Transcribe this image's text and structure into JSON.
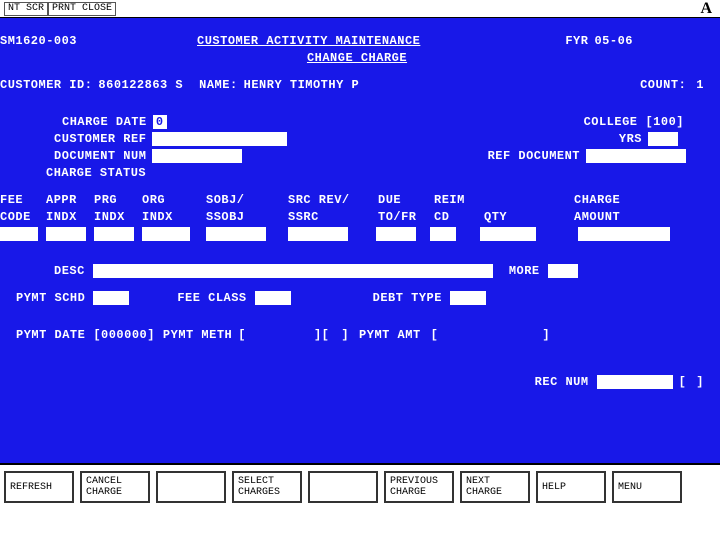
{
  "topbar": {
    "btn1": "NT SCR",
    "btn2": "PRNT CLOSE",
    "marker": "A"
  },
  "header": {
    "code": "SM1620-003",
    "title": "CUSTOMER ACTIVITY MAINTENANCE",
    "subtitle": "CHANGE CHARGE",
    "fyr_lbl": "FYR",
    "fyr_val": "05-06"
  },
  "cust": {
    "id_lbl": "CUSTOMER ID:",
    "id_val": "860122863 S",
    "name_lbl": "NAME:",
    "name_val": "HENRY TIMOTHY P",
    "count_lbl": "COUNT:",
    "count_val": "1"
  },
  "fields": {
    "charge_date": "CHARGE DATE",
    "charge_date_val": "0",
    "college": "COLLEGE",
    "college_val": "[100]",
    "cust_ref": "CUSTOMER REF",
    "yrs": "YRS",
    "doc_num": "DOCUMENT NUM",
    "ref_doc": "REF DOCUMENT",
    "charge_status": "CHARGE STATUS"
  },
  "cols": {
    "c1a": "FEE",
    "c1b": "CODE",
    "c2a": "APPR",
    "c2b": "INDX",
    "c3a": "PRG",
    "c3b": "INDX",
    "c4a": "ORG",
    "c4b": "INDX",
    "c5a": "SOBJ/",
    "c5b": "SSOBJ",
    "c6a": "SRC REV/",
    "c6b": "SSRC",
    "c7a": "DUE",
    "c7b": "TO/FR",
    "c8a": "REIM",
    "c8b": "CD",
    "c9": "QTY",
    "c10a": "CHARGE",
    "c10b": "AMOUNT"
  },
  "desc": {
    "lbl": "DESC",
    "more": "MORE"
  },
  "pymt": {
    "schd": "PYMT SCHD",
    "fee_class": "FEE CLASS",
    "debt_type": "DEBT TYPE"
  },
  "pline": {
    "date_lbl": "PYMT DATE",
    "date_val": "[000000]",
    "meth_lbl": "PYMT METH",
    "br1": "[",
    "br2": "][",
    "br3": "]",
    "amt_lbl": "PYMT AMT",
    "br4": "[",
    "br5": "]"
  },
  "rec": {
    "lbl": "REC NUM",
    "br1": "[",
    "br2": "]"
  },
  "fkeys": [
    "REFRESH",
    "CANCEL\nCHARGE",
    "",
    "SELECT\nCHARGES",
    "",
    "PREVIOUS\nCHARGE",
    "NEXT\nCHARGE",
    "HELP",
    "MENU"
  ]
}
